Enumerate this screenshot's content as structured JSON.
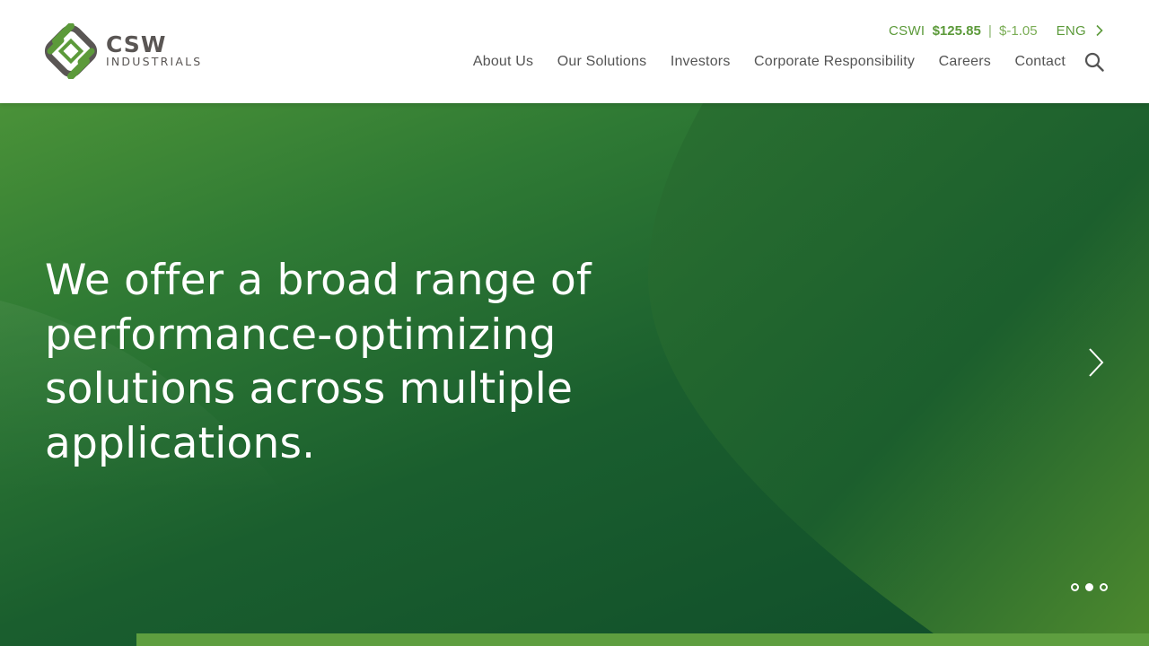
{
  "brand": {
    "name_line1": "CSW",
    "name_line2": "INDUSTRIALS",
    "logo_icon": "csw-diamond-logo-icon",
    "colors": {
      "green": "#5c9a3a",
      "gray": "#5a5654"
    }
  },
  "utility": {
    "ticker_symbol": "CSWI",
    "ticker_price": "$125.85",
    "ticker_separator": "|",
    "ticker_change": "$-1.05",
    "language": "ENG",
    "language_icon": "chevron-right-icon"
  },
  "nav": {
    "items": [
      {
        "label": "About Us"
      },
      {
        "label": "Our Solutions"
      },
      {
        "label": "Investors"
      },
      {
        "label": "Corporate Responsibility"
      },
      {
        "label": "Careers"
      },
      {
        "label": "Contact"
      }
    ],
    "search_icon": "search-icon"
  },
  "hero": {
    "headline": "We offer a broad range of performance-optimizing solutions across multiple applications.",
    "next_icon": "chevron-right-icon",
    "slides_total": 3,
    "active_slide": 2,
    "colors": {
      "dark_green": "#0f4c2a",
      "light_green": "#4a9238",
      "accent_bar": "#5e9e3f"
    }
  }
}
